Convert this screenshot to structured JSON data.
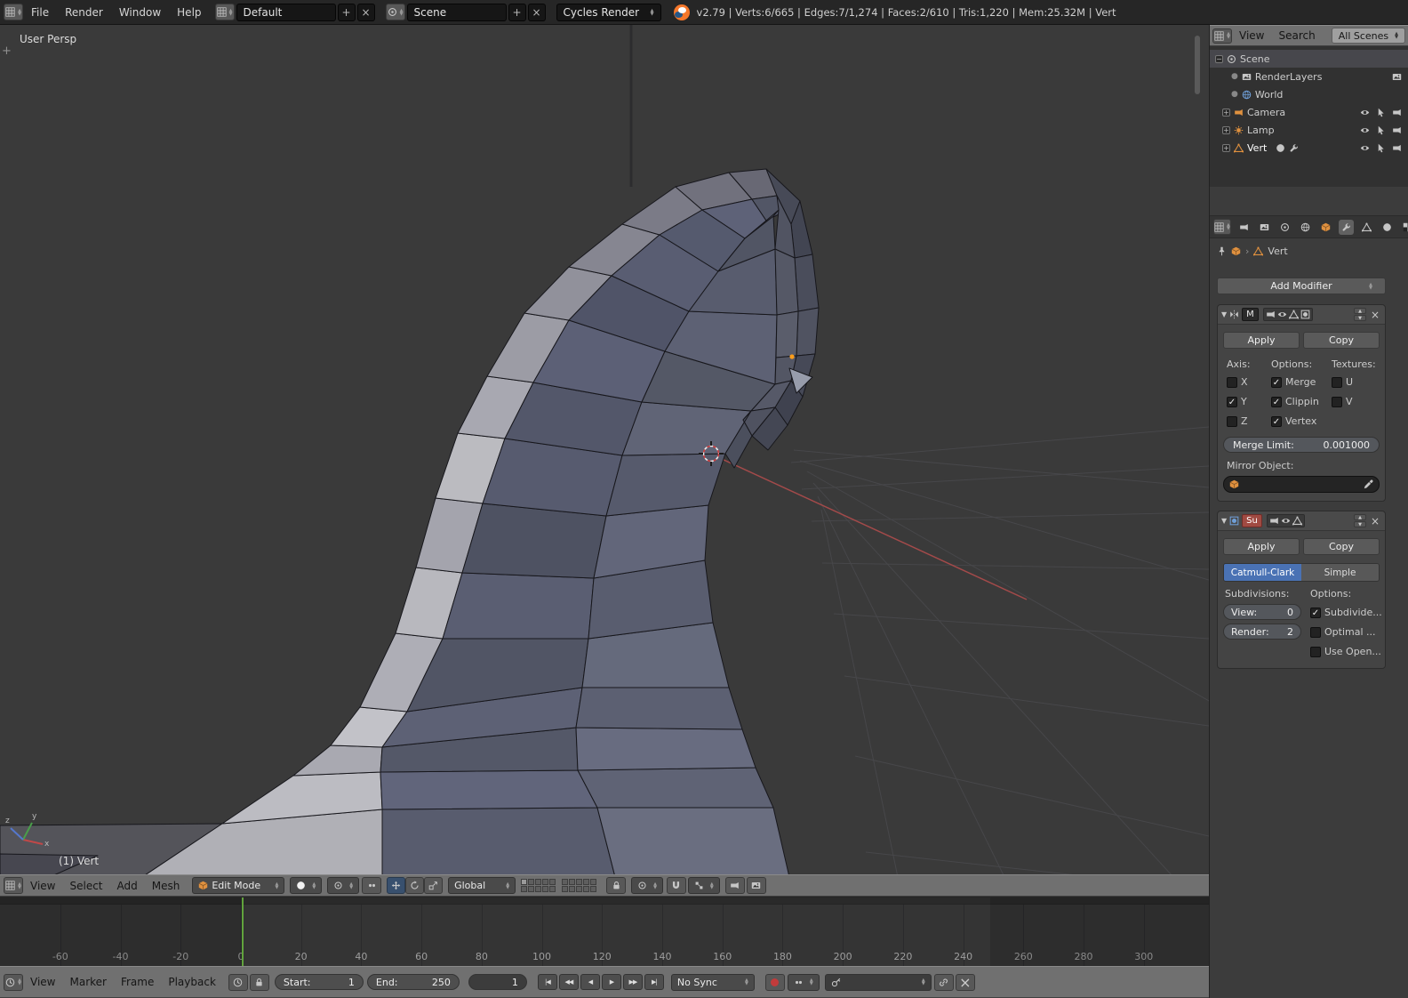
{
  "top_bar": {
    "menus": [
      "File",
      "Render",
      "Window",
      "Help"
    ],
    "layout": "Default",
    "scene": "Scene",
    "engine": "Cycles Render",
    "stats": "v2.79 | Verts:6/665 | Edges:7/1,274 | Faces:2/610 | Tris:1,220 | Mem:25.32M | Vert"
  },
  "viewport": {
    "view_label": "User Persp",
    "object_info": "(1) Vert",
    "axis_x": "x",
    "axis_y": "y",
    "axis_z": "z"
  },
  "header_3d": {
    "menus": [
      "View",
      "Select",
      "Add",
      "Mesh"
    ],
    "mode": "Edit Mode",
    "orientation": "Global"
  },
  "outliner": {
    "view": "View",
    "search": "Search",
    "display_mode": "All Scenes",
    "items": [
      "Scene",
      "RenderLayers",
      "World",
      "Camera",
      "Lamp",
      "Vert"
    ]
  },
  "properties": {
    "context_name": "Vert",
    "add_modifier": "Add Modifier",
    "mirror": {
      "name": "M",
      "apply": "Apply",
      "copy": "Copy",
      "axis_label": "Axis:",
      "options_label": "Options:",
      "textures_label": "Textures:",
      "axis_x": "X",
      "axis_y": "Y",
      "axis_z": "Z",
      "opt_merge": "Merge",
      "opt_clipping": "Clippin",
      "opt_vertex": "Vertex",
      "tex_u": "U",
      "tex_v": "V",
      "merge_limit_label": "Merge Limit:",
      "merge_limit_value": "0.001000",
      "mirror_object_label": "Mirror Object:"
    },
    "subsurf": {
      "name": "Su",
      "apply": "Apply",
      "copy": "Copy",
      "type_a": "Catmull-Clark",
      "type_b": "Simple",
      "subdivisions_label": "Subdivisions:",
      "options_label": "Options:",
      "view_label": "View:",
      "view_value": "0",
      "render_label": "Render:",
      "render_value": "2",
      "opt_subdivide": "Subdivide...",
      "opt_optimal": "Optimal ...",
      "opt_opensubdiv": "Use Open..."
    },
    "states": {
      "mirror_x": false,
      "mirror_y": true,
      "mirror_z": false,
      "merge": true,
      "clipping": true,
      "vertex_groups": true,
      "u": false,
      "v": false,
      "subdivide_uvs": true,
      "optimal_display": false,
      "use_opensubdiv": false
    }
  },
  "timeline": {
    "menus": [
      "View",
      "Marker",
      "Frame",
      "Playback"
    ],
    "start_label": "Start:",
    "start_value": "1",
    "end_label": "End:",
    "end_value": "250",
    "current_frame": "1",
    "sync_mode": "No Sync",
    "transport": [
      "|◀",
      "◀◀",
      "◀",
      "▶",
      "▶▶",
      "▶|"
    ],
    "ruler_labels": [
      "-60",
      "-40",
      "-20",
      "0",
      "20",
      "40",
      "60",
      "80",
      "100",
      "120",
      "140",
      "160",
      "180",
      "200",
      "220",
      "240",
      "260",
      "280",
      "300"
    ]
  }
}
